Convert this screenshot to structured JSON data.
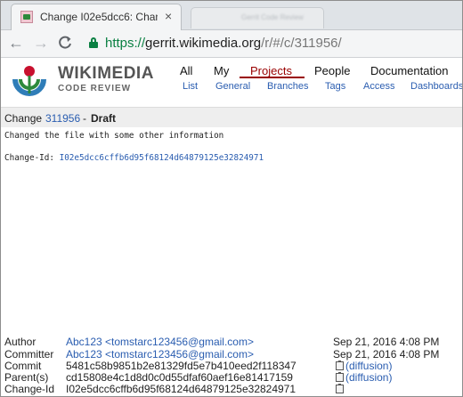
{
  "browser": {
    "active_tab_title": "Change I02e5dcc6: Chan",
    "inactive_tab_title": "Gerrit Code Review",
    "url_scheme": "https://",
    "url_host": "gerrit.wikimedia.org",
    "url_path": "/r/#/c/311956/"
  },
  "site": {
    "brand_name": "WIKIMEDIA",
    "brand_sub": "CODE REVIEW",
    "top_menu": [
      "All",
      "My",
      "Projects",
      "People",
      "Documentation"
    ],
    "selected_menu": "Projects",
    "sub_menu": [
      "List",
      "General",
      "Branches",
      "Tags",
      "Access",
      "Dashboards"
    ]
  },
  "change": {
    "prefix": "Change",
    "number": "311956",
    "dash": "-",
    "status": "Draft",
    "message": "Changed the file with some other information",
    "change_id_label": "Change-Id:",
    "change_id": "I02e5dcc6cffb6d95f68124d64879125e32824971"
  },
  "info": {
    "author_label": "Author",
    "author": "Abc123 <tomstarc123456@gmail.com>",
    "author_date": "Sep 21, 2016 4:08 PM",
    "committer_label": "Committer",
    "committer": "Abc123 <tomstarc123456@gmail.com>",
    "committer_date": "Sep 21, 2016 4:08 PM",
    "commit_label": "Commit",
    "commit": "5481c58b9851b2e81329fd5e7b410eed2f118347",
    "commit_link": "(diffusion)",
    "parent_label": "Parent(s)",
    "parent": "cd15808e4c1d8d0c0d55dfaf60aef16e81417159",
    "parent_link": "(diffusion)",
    "changeid_label": "Change-Id",
    "changeid": "I02e5dcc6cffb6d95f68124d64879125e32824971"
  },
  "colors": {
    "link": "#2a5db0",
    "selected_menu": "#990000",
    "secure_green": "#0b8043"
  }
}
